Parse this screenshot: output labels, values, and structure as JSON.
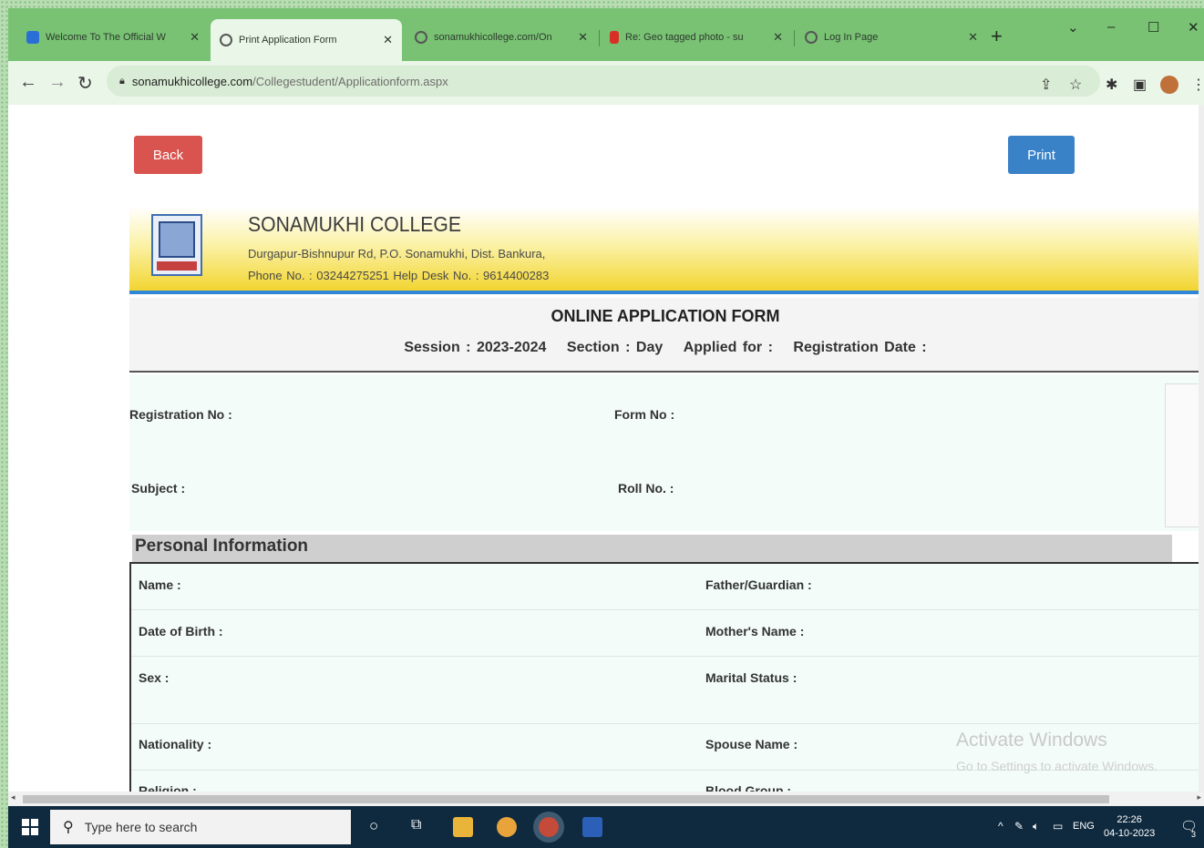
{
  "browser": {
    "tabs": [
      {
        "title": "Welcome To The Official W",
        "favicon_color": "#2a6fd6",
        "active": false
      },
      {
        "title": "Print Application Form",
        "favicon_color": "#555555",
        "active": true
      },
      {
        "title": "sonamukhicollege.com/On",
        "favicon_color": "#555555",
        "active": false
      },
      {
        "title": "Re: Geo tagged photo - su",
        "favicon_color": "#d93025",
        "active": false
      },
      {
        "title": "Log In Page",
        "favicon_color": "#555555",
        "active": false
      }
    ],
    "url_domain": "sonamukhicollege.com",
    "url_path": "/Collegestudent/Applicationform.aspx"
  },
  "page": {
    "back_label": "Back",
    "print_label": "Print",
    "college_name": "SONAMUKHI COLLEGE",
    "address": "Durgapur-Bishnupur Rd, P.O. Sonamukhi, Dist. Bankura,",
    "phone_line": "Phone No. : 03244275251   Help Desk No. : 9614400283",
    "form_title": "ONLINE APPLICATION FORM",
    "session": "Session : 2023-2024",
    "section": "Section : Day",
    "applied_for": "Applied for :",
    "registration_date": "Registration Date :",
    "registration_no": "Registration No :",
    "form_no": "Form No :",
    "subject": "Subject :",
    "roll_no": "Roll No. :",
    "personal_heading": "Personal Information",
    "personal_fields": {
      "name": "Name :",
      "father": "Father/Guardian :",
      "dob": "Date of Birth :",
      "mother": "Mother's Name :",
      "sex": "Sex :",
      "marital": "Marital Status :",
      "nationality": "Nationality :",
      "spouse": "Spouse Name :",
      "religion": "Religion :",
      "blood": "Blood Group :"
    },
    "watermark_title": "Activate Windows",
    "watermark_sub": "Go to Settings to activate Windows."
  },
  "taskbar": {
    "search_placeholder": "Type here to search",
    "lang": "ENG",
    "time": "22:26",
    "date": "04-10-2023",
    "notification_count": "3"
  }
}
